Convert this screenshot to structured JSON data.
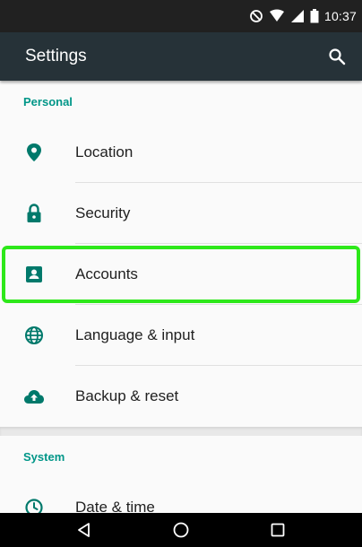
{
  "status_bar": {
    "time": "10:37",
    "icons": [
      "do-not-disturb-icon",
      "wifi-icon",
      "signal-icon",
      "battery-icon"
    ]
  },
  "app_bar": {
    "title": "Settings",
    "search_icon": "search-icon"
  },
  "sections": [
    {
      "header": "Personal",
      "items": [
        {
          "label": "Location",
          "icon": "location-pin-icon"
        },
        {
          "label": "Security",
          "icon": "lock-icon"
        },
        {
          "label": "Accounts",
          "icon": "account-box-icon",
          "highlighted": true
        },
        {
          "label": "Language & input",
          "icon": "globe-icon"
        },
        {
          "label": "Backup & reset",
          "icon": "cloud-upload-icon"
        }
      ]
    },
    {
      "header": "System",
      "items": [
        {
          "label": "Date & time",
          "icon": "clock-icon"
        }
      ]
    }
  ],
  "nav_bar": {
    "buttons": [
      "back-icon",
      "home-icon",
      "recents-icon"
    ]
  },
  "colors": {
    "status_bar": "#212121",
    "app_bar": "#263238",
    "accent": "#009688",
    "highlight": "#2ee81a",
    "background": "#fafafa"
  }
}
